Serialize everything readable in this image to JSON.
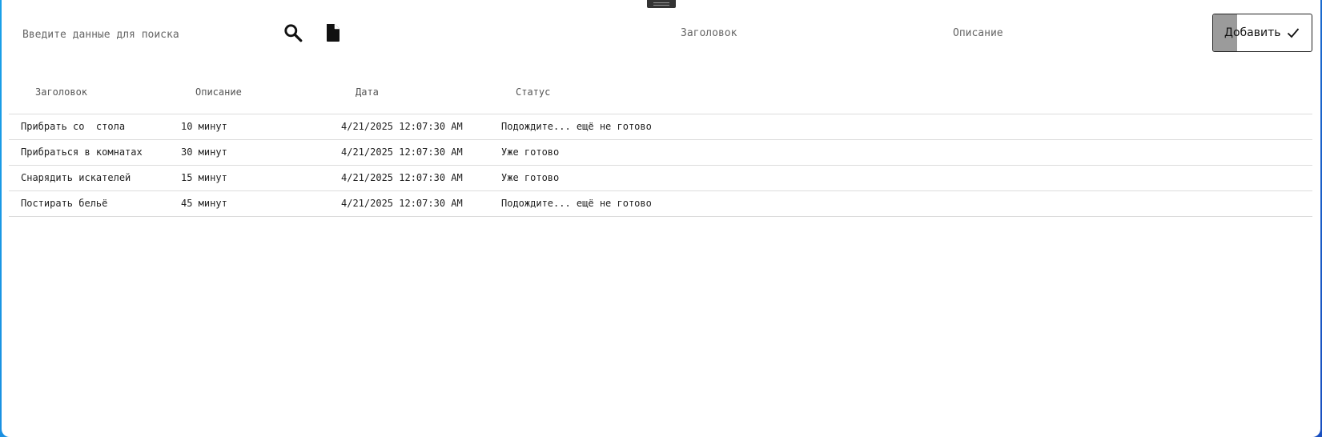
{
  "search": {
    "placeholder": "Введите данные для поиска"
  },
  "icons": {
    "search": "search-icon",
    "document": "document-icon",
    "check": "check-icon"
  },
  "form": {
    "title_placeholder": "Заголовок",
    "description_placeholder": "Описание",
    "add_label": "Добавить"
  },
  "table": {
    "headers": [
      "Заголовок",
      "Описание",
      "Дата",
      "Статус"
    ],
    "rows": [
      [
        "Прибрать со  стола",
        "10 минут",
        "4/21/2025 12:07:30 AM",
        "Подождите... ещё не готово"
      ],
      [
        "Прибраться в комнатах",
        "30 минут",
        "4/21/2025 12:07:30 AM",
        "Уже готово"
      ],
      [
        "Снарядить искателей",
        "15 минут",
        "4/21/2025 12:07:30 AM",
        "Уже готово"
      ],
      [
        "Постирать бельё",
        "45 минут",
        "4/21/2025 12:07:30 AM",
        "Подождите... ещё не готово"
      ]
    ]
  }
}
